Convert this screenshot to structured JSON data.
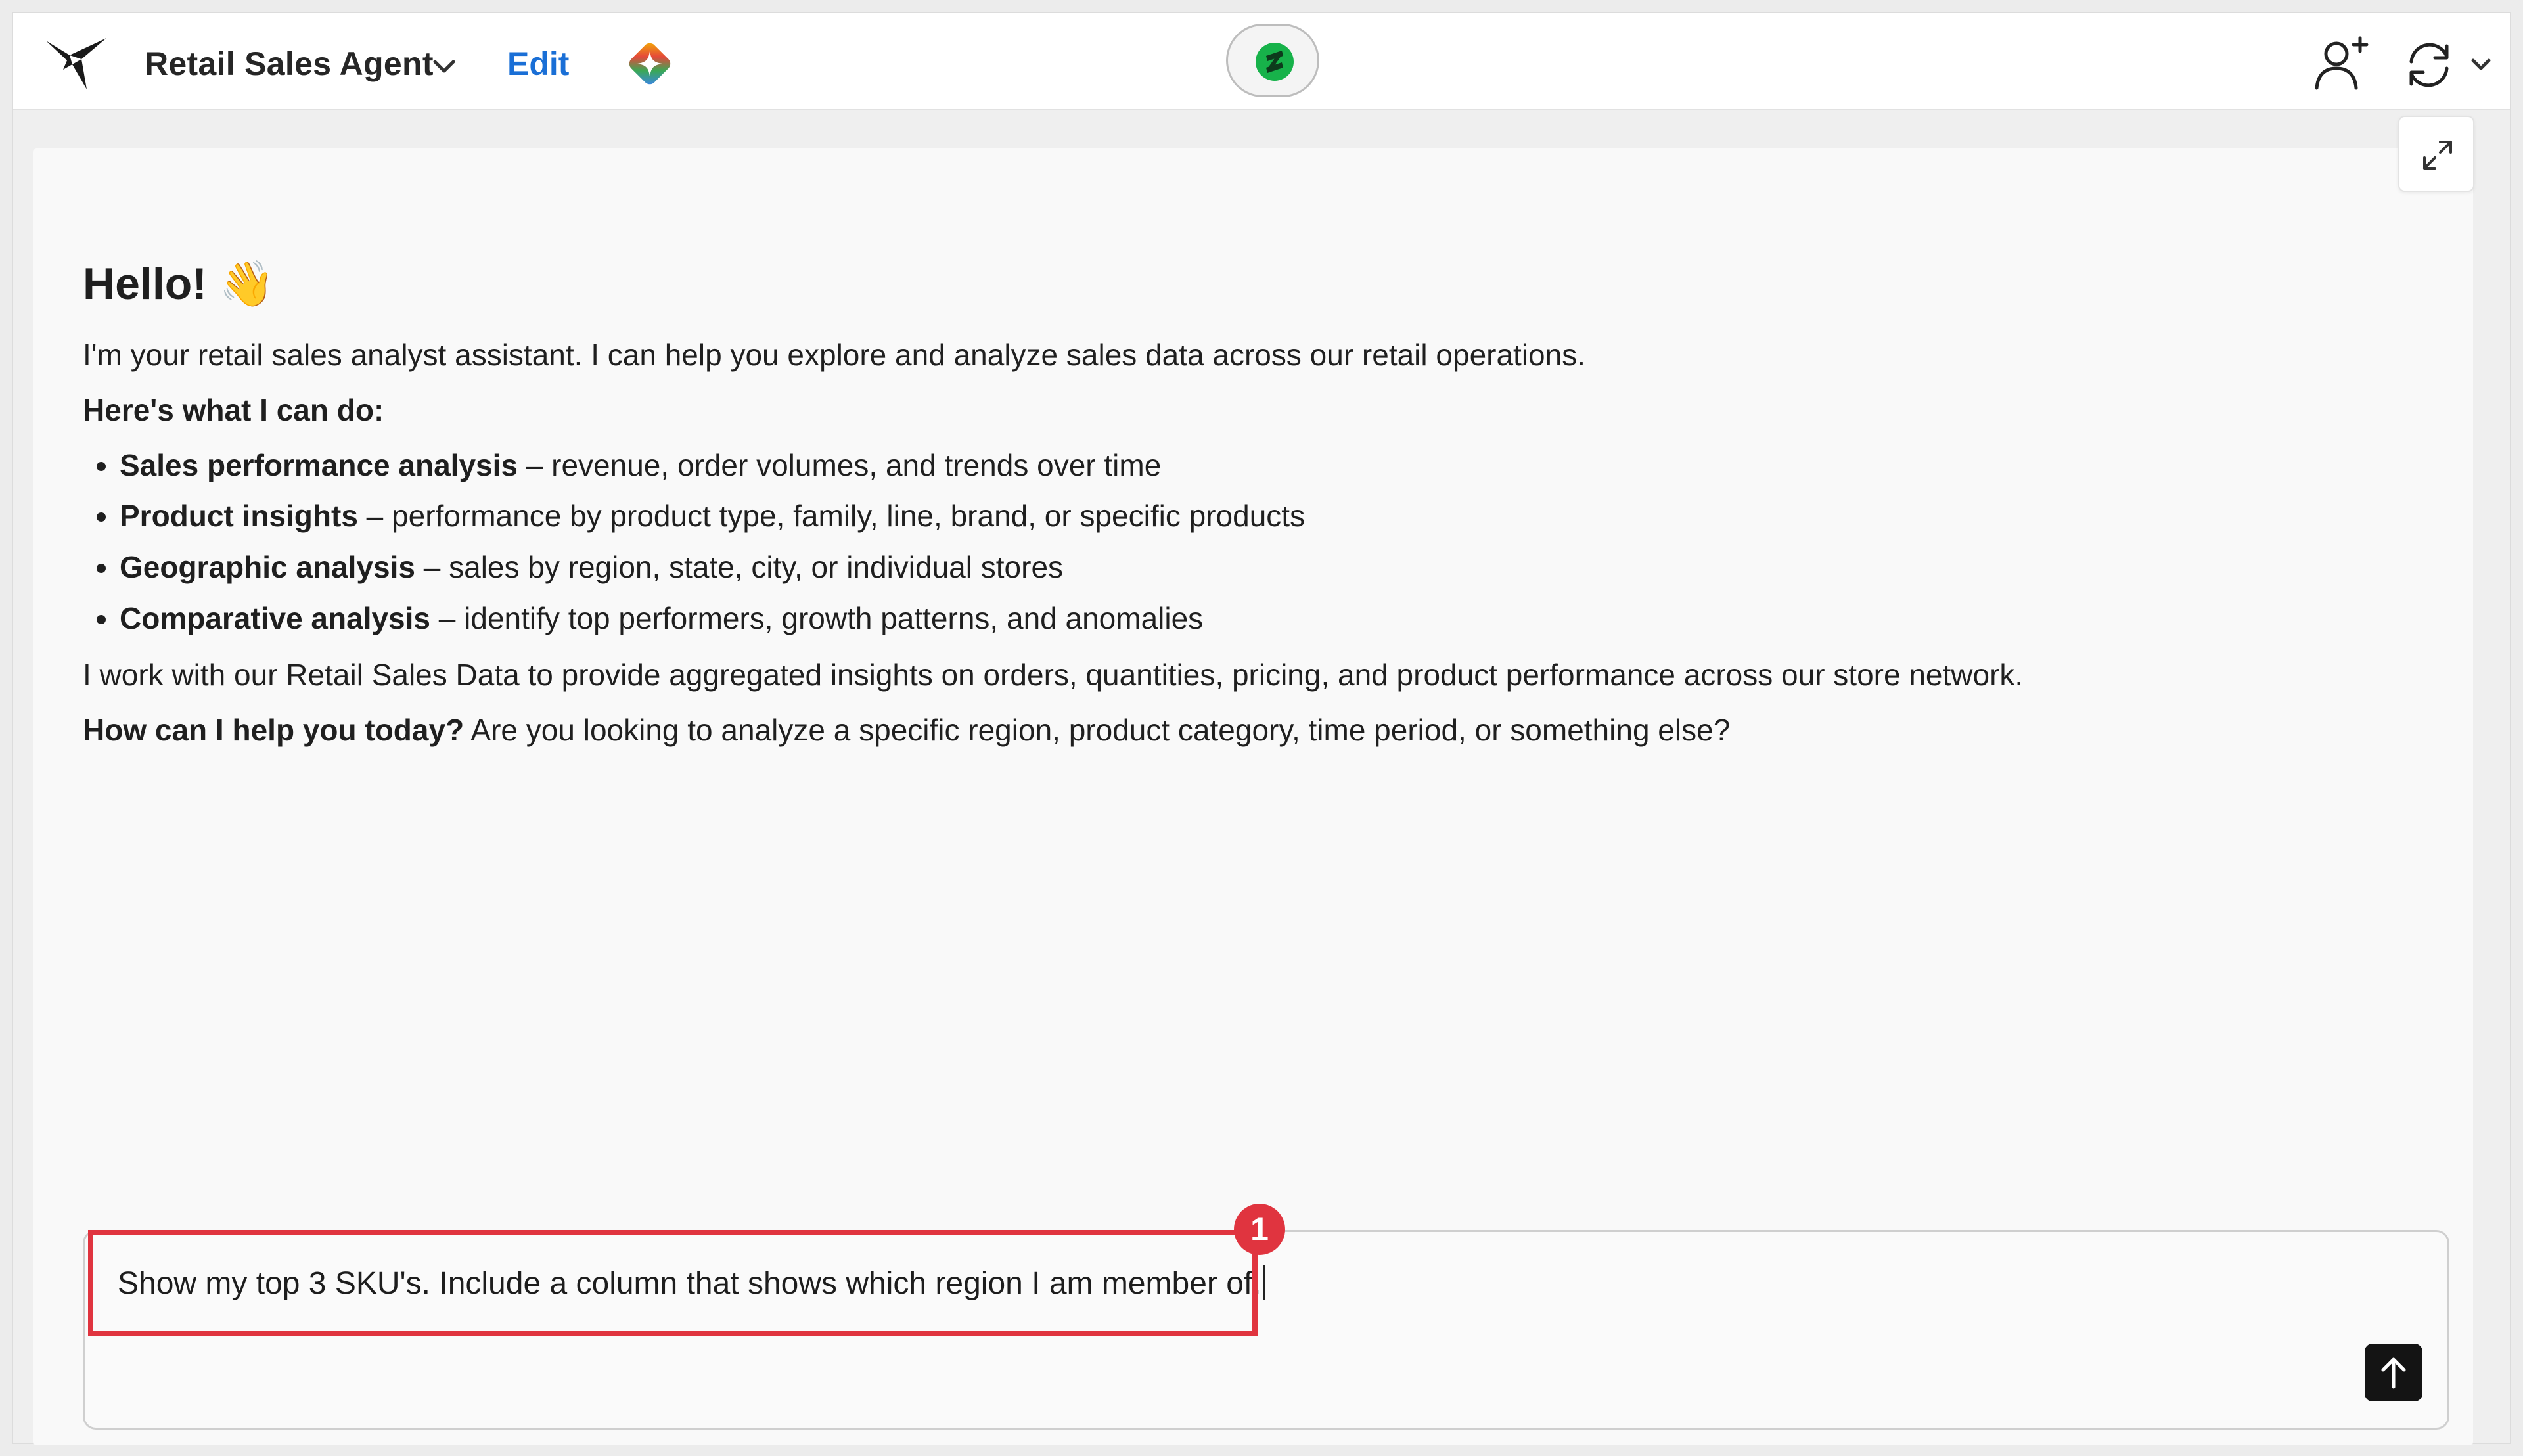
{
  "header": {
    "agent_name": "Retail Sales Agent",
    "edit_label": "Edit"
  },
  "chat": {
    "greeting": "Hello! 👋",
    "intro": "I'm your retail sales analyst assistant. I can help you explore and analyze sales data across our retail operations.",
    "capabilities_heading": "Here's what I can do:",
    "capabilities": [
      {
        "title": "Sales performance analysis",
        "desc": " – revenue, order volumes, and trends over time"
      },
      {
        "title": "Product insights",
        "desc": " – performance by product type, family, line, brand, or specific products"
      },
      {
        "title": "Geographic analysis",
        "desc": " – sales by region, state, city, or individual stores"
      },
      {
        "title": "Comparative analysis",
        "desc": " – identify top performers, growth patterns, and anomalies"
      }
    ],
    "data_note": "I work with our Retail Sales Data to provide aggregated insights on orders, quantities, pricing, and product performance across our store network.",
    "closing_bold": "How can I help you today?",
    "closing_rest": " Are you looking to analyze a specific region, product category, time period, or something else?"
  },
  "input": {
    "value": "Show my top 3 SKU's. Include a column that shows which region I am member of."
  },
  "annotation": {
    "step_number": "1",
    "color": "#e0343f"
  },
  "icons": {
    "logo": "bird-logo-icon",
    "agent_dropdown": "chevron-down-icon",
    "ai": "sparkle-diamond-icon",
    "center": "brand-badge-icon",
    "add_user": "user-plus-icon",
    "refresh": "refresh-icon",
    "refresh_menu": "chevron-down-icon",
    "expand": "expand-icon",
    "send": "arrow-up-icon"
  }
}
